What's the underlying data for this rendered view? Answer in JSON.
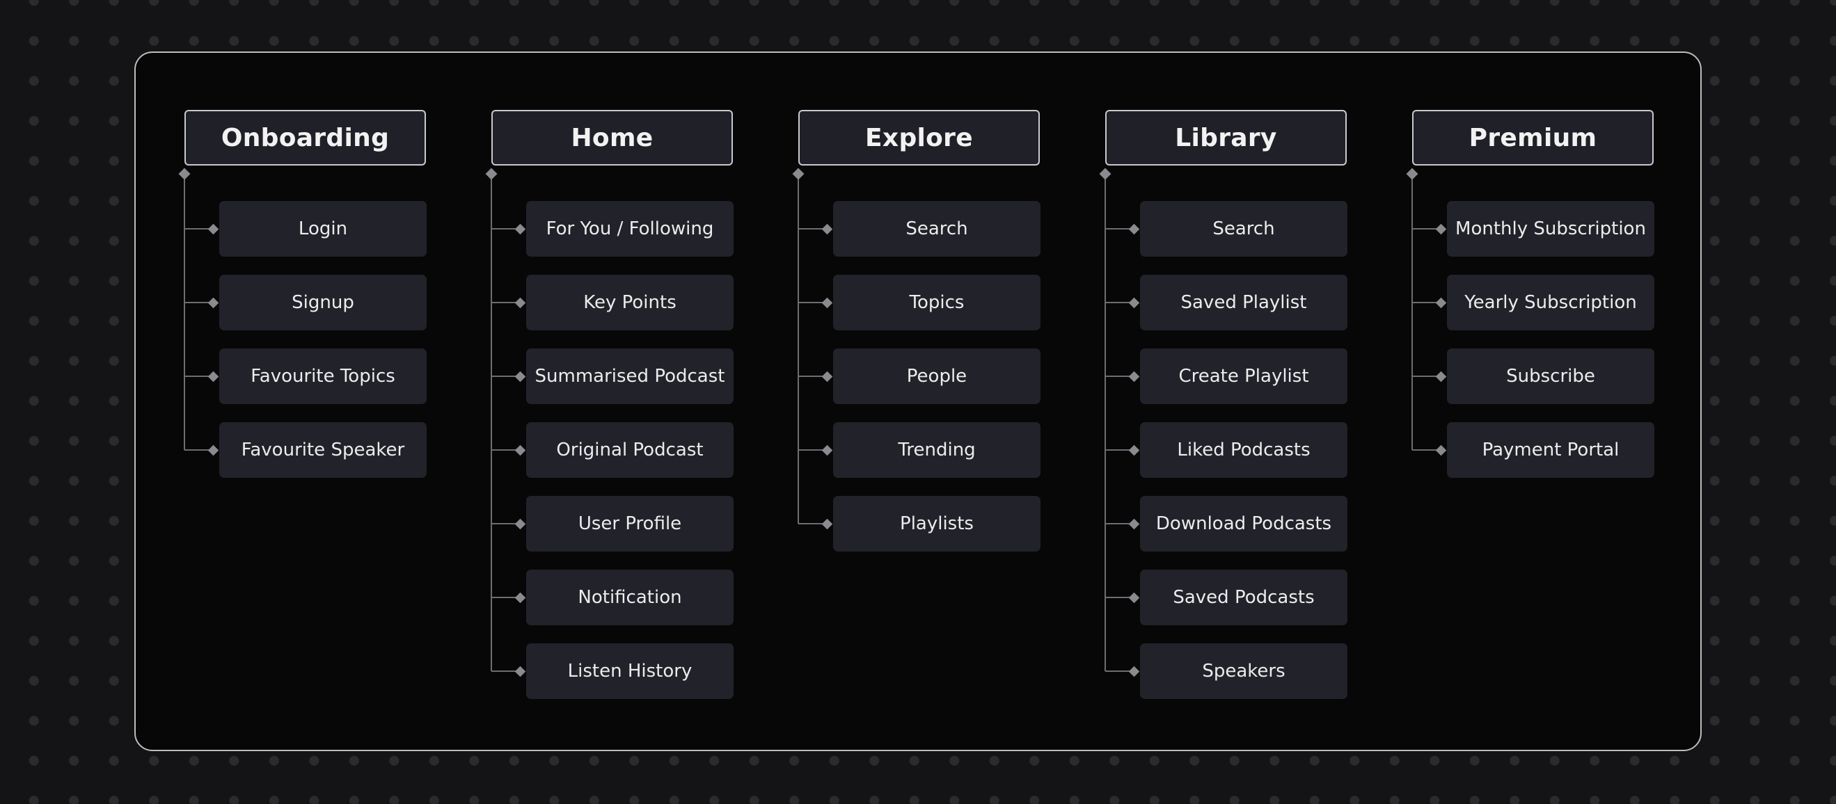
{
  "columns": [
    {
      "title": "Onboarding",
      "items": [
        "Login",
        "Signup",
        "Favourite Topics",
        "Favourite Speaker"
      ]
    },
    {
      "title": "Home",
      "items": [
        "For You / Following",
        "Key Points",
        "Summarised Podcast",
        "Original Podcast",
        "User Profile",
        "Notification",
        "Listen History"
      ]
    },
    {
      "title": "Explore",
      "items": [
        "Search",
        "Topics",
        "People",
        "Trending",
        "Playlists"
      ]
    },
    {
      "title": "Library",
      "items": [
        "Search",
        "Saved Playlist",
        "Create Playlist",
        "Liked Podcasts",
        "Download Podcasts",
        "Saved Podcasts",
        "Speakers"
      ]
    },
    {
      "title": "Premium",
      "items": [
        "Monthly Subscription",
        "Yearly Subscription",
        "Subscribe",
        "Payment Portal"
      ]
    }
  ]
}
